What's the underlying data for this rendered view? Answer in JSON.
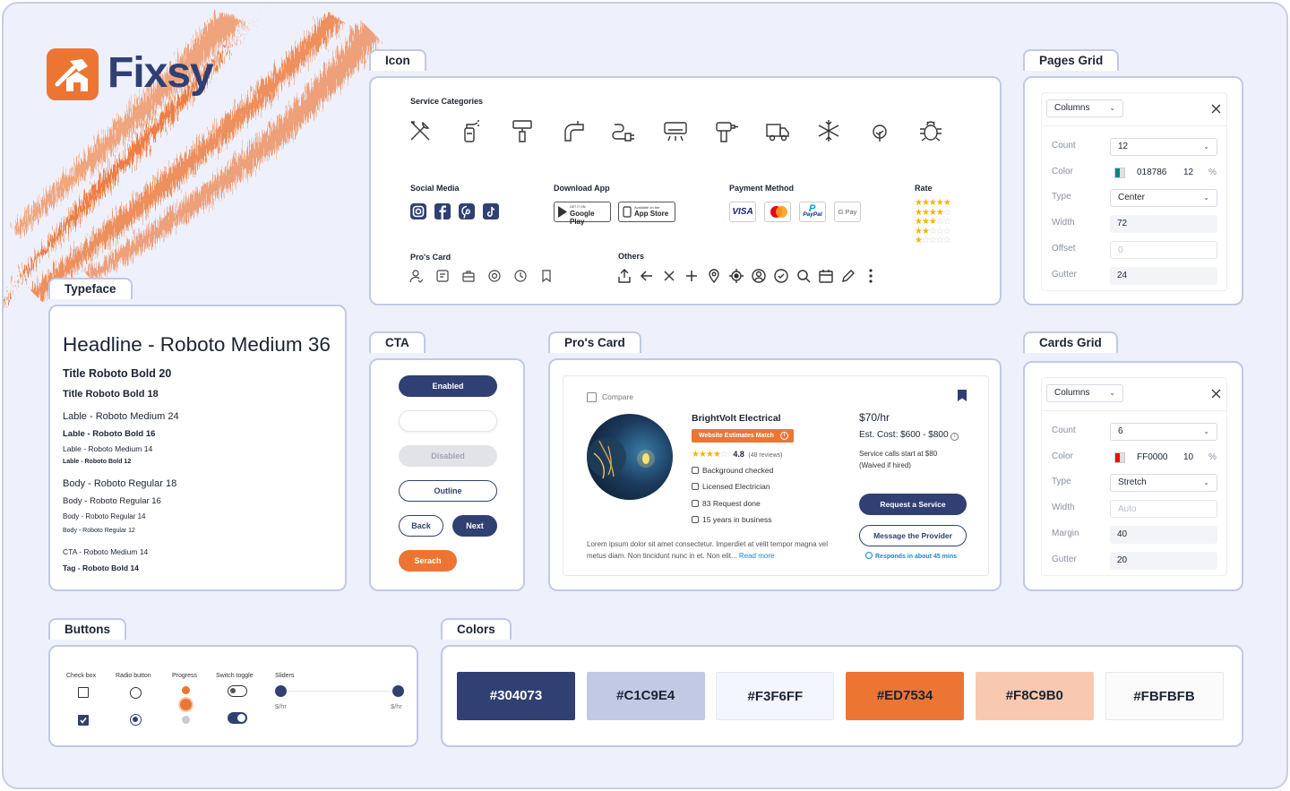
{
  "brand": {
    "name": "Fixsy",
    "logo_color": "#ED7534",
    "text_color": "#304073"
  },
  "tags": {
    "icon": "Icon",
    "pages_grid": "Pages Grid",
    "typeface": "Typeface",
    "cta": "CTA",
    "pros_card": "Pro's Card",
    "cards_grid": "Cards Grid",
    "buttons": "Buttons",
    "colors": "Colors"
  },
  "icons": {
    "service_categories": "Service Categories",
    "service_icons": [
      "tools-icon",
      "spray-bottle-icon",
      "paint-roller-icon",
      "faucet-icon",
      "plug-icon",
      "air-conditioner-icon",
      "drill-icon",
      "truck-icon",
      "snowflake-icon",
      "tree-icon",
      "bug-icon"
    ],
    "social_media": "Social Media",
    "download_app": "Download App",
    "google_play_small": "GET IT ON",
    "google_play": "Google Play",
    "app_store_small": "Available on the",
    "app_store": "App Store",
    "payment_method": "Payment Method",
    "payments": {
      "visa": "VISA",
      "paypal": "PayPal",
      "gpay": "G Pay"
    },
    "rate": "Rate",
    "pros_card": "Pro's Card",
    "others": "Others"
  },
  "typeface": {
    "headline": "Headline - Roboto Medium 36",
    "title20": "Title Roboto Bold 20",
    "title18": "Title Roboto Bold 18",
    "label24": "Lable - Roboto Medium 24",
    "label16": "Lable - Roboto Bold 16",
    "label14": "Lable - Roboto Medium 14",
    "label12": "Lable - Roboto Bold 12",
    "body18": "Body - Roboto Regular 18",
    "body16": "Body - Roboto Regular 16",
    "body14": "Body - Roboto Regular 14",
    "body12": "Body - Roboto Regular 12",
    "cta14": "CTA - Roboto Medium 14",
    "tag14": "Tag - Roboto Bold 14"
  },
  "cta": {
    "enabled": "Enabled",
    "hover": "",
    "disabled": "Disabled",
    "outline": "Outline",
    "back": "Back",
    "next": "Next",
    "search": "Serach"
  },
  "pro_card": {
    "compare": "Compare",
    "name": "BrightVolt Electrical",
    "badge": "Website Estimates Match",
    "rating": "4.8",
    "reviews": "(48 reviews)",
    "features": [
      "Background checked",
      "Licensed Electrician",
      "83 Request done",
      "15 years in business"
    ],
    "rate": "$70/hr",
    "est_cost": "Est. Cost: $600 - $800",
    "service_calls": "Service calls start at $80",
    "waived": "(Waived if hired)",
    "request_btn": "Request a Service",
    "message_btn": "Message the Provider",
    "responds": "Responds in about 45 mins",
    "description": "Lorem ipsum dolor sit amet consectetur. Imperdiet at velit tempor magna vel metus diam. Non tincidunt nunc in et. Non elit...",
    "read_more": "Read more"
  },
  "pages_grid": {
    "dropdown": "Columns",
    "rows": [
      {
        "label": "Count",
        "value": "12",
        "kind": "select"
      },
      {
        "label": "Color",
        "value": "018786",
        "opacity": "12",
        "pct": "%",
        "kind": "color",
        "swatch": "#018786"
      },
      {
        "label": "Type",
        "value": "Center",
        "kind": "select"
      },
      {
        "label": "Width",
        "value": "72",
        "kind": "field"
      },
      {
        "label": "Offset",
        "value": "0",
        "kind": "placeholder"
      },
      {
        "label": "Gutter",
        "value": "24",
        "kind": "field"
      }
    ]
  },
  "cards_grid": {
    "dropdown": "Columns",
    "rows": [
      {
        "label": "Count",
        "value": "6",
        "kind": "select"
      },
      {
        "label": "Color",
        "value": "FF0000",
        "opacity": "10",
        "pct": "%",
        "kind": "color",
        "swatch": "#FF0000"
      },
      {
        "label": "Type",
        "value": "Stretch",
        "kind": "select"
      },
      {
        "label": "Width",
        "value": "Auto",
        "kind": "placeholder"
      },
      {
        "label": "Margin",
        "value": "40",
        "kind": "field"
      },
      {
        "label": "Gutter",
        "value": "20",
        "kind": "field"
      }
    ]
  },
  "controls": {
    "checkbox": "Check box",
    "radio": "Radio button",
    "progress": "Progress",
    "switch": "Switch toggle",
    "sliders": "Sliders",
    "slider_unit": "$/hr"
  },
  "colors": [
    {
      "hex": "#304073",
      "label": "#304073",
      "text": "#ffffff"
    },
    {
      "hex": "#C1C9E4",
      "label": "#C1C9E4",
      "text": "#1c2333"
    },
    {
      "hex": "#F3F6FF",
      "label": "#F3F6FF",
      "text": "#1c2333"
    },
    {
      "hex": "#ED7534",
      "label": "#ED7534",
      "text": "#1c2333"
    },
    {
      "hex": "#F8C9B0",
      "label": "#F8C9B0",
      "text": "#1c2333"
    },
    {
      "hex": "#FBFBFB",
      "label": "#FBFBFB",
      "text": "#1c2333"
    }
  ]
}
